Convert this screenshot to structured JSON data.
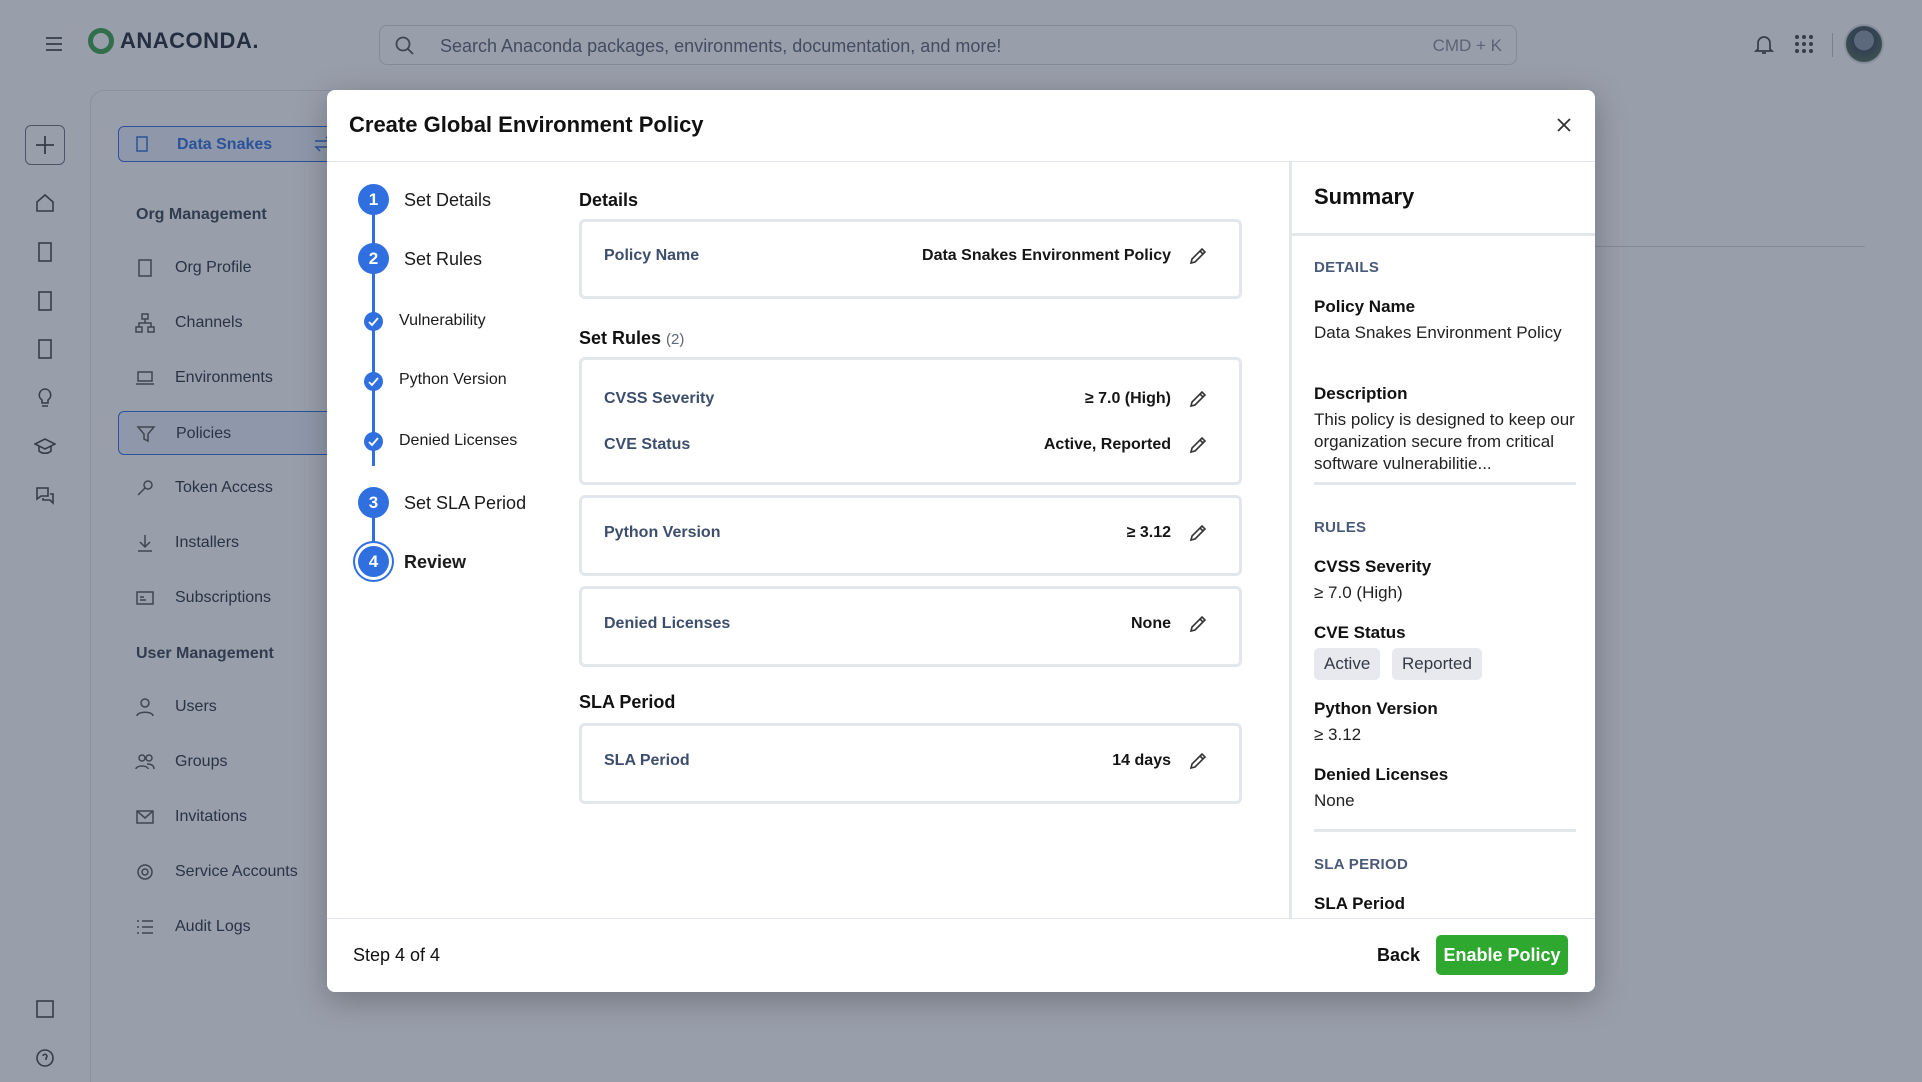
{
  "app": {
    "logo_text": "ANACONDA."
  },
  "search": {
    "placeholder": "Search Anaconda packages, environments, documentation, and more!",
    "shortcut": "CMD + K"
  },
  "org_switcher": {
    "label": "Data Snakes"
  },
  "nav": {
    "org_management_heading": "Org Management",
    "org_items": [
      "Org Profile",
      "Channels",
      "Environments",
      "Policies",
      "Token Access",
      "Installers",
      "Subscriptions"
    ],
    "user_management_heading": "User Management",
    "user_items": [
      "Users",
      "Groups",
      "Invitations",
      "Service Accounts",
      "Audit Logs"
    ],
    "active_item": "Policies"
  },
  "modal": {
    "title": "Create Global Environment Policy",
    "steps": [
      {
        "number": "1",
        "label": "Set Details"
      },
      {
        "number": "2",
        "label": "Set Rules"
      },
      {
        "number": "3",
        "label": "Set SLA Period"
      },
      {
        "number": "4",
        "label": "Review"
      }
    ],
    "substeps": [
      "Vulnerability",
      "Python Version",
      "Denied Licenses"
    ],
    "details": {
      "heading": "Details",
      "policy_name_label": "Policy Name",
      "policy_name_value": "Data Snakes Environment Policy"
    },
    "rules": {
      "heading": "Set Rules",
      "count": "(2)",
      "cvss_label": "CVSS Severity",
      "cvss_value": "≥ 7.0 (High)",
      "cve_label": "CVE Status",
      "cve_value": "Active, Reported",
      "python_label": "Python Version",
      "python_value": "≥ 3.12",
      "licenses_label": "Denied Licenses",
      "licenses_value": "None"
    },
    "sla": {
      "heading": "SLA Period",
      "label": "SLA Period",
      "value": "14 days"
    },
    "summary": {
      "title": "Summary",
      "details_heading": "DETAILS",
      "policy_name_key": "Policy Name",
      "policy_name_value": "Data Snakes Environment Policy",
      "description_key": "Description",
      "description_value": "This policy is designed to keep our organization secure from critical software vulnerabilitie...",
      "rules_heading": "RULES",
      "cvss_key": "CVSS Severity",
      "cvss_value": "≥ 7.0 (High)",
      "cve_key": "CVE Status",
      "cve_chips": [
        "Active",
        "Reported"
      ],
      "python_key": "Python Version",
      "python_value": "≥ 3.12",
      "licenses_key": "Denied Licenses",
      "licenses_value": "None",
      "sla_heading": "SLA PERIOD",
      "sla_key": "SLA Period"
    },
    "footer": {
      "step_text": "Step 4 of 4",
      "back_label": "Back",
      "enable_label": "Enable Policy"
    }
  },
  "colors": {
    "primary": "#2f6fe0",
    "success": "#2fa82f",
    "overlay": "#28344e"
  }
}
